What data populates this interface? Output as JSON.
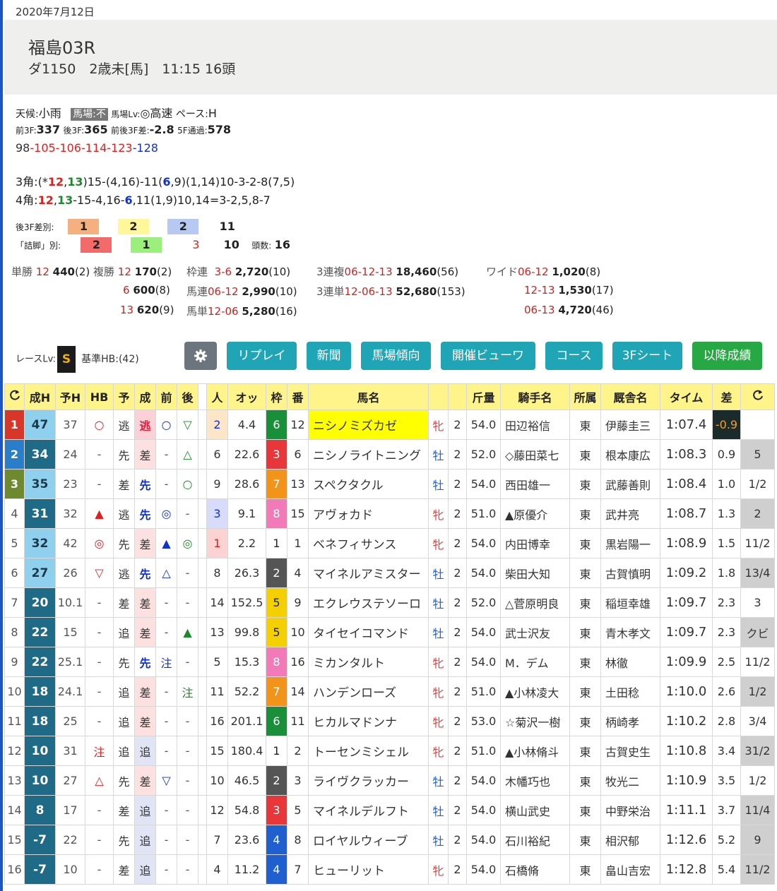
{
  "date": "2020年7月12日",
  "race": {
    "title": "福島03R",
    "sub": "ダ1150　2歳未[馬]　11:15 16頭"
  },
  "info": {
    "weather_label": "天候:",
    "weather": "小雨",
    "track_label": "馬場:",
    "track": "不",
    "tracklv_label": "馬場Lv:",
    "tracklv": "◎高速",
    "pace_label": "ペース:",
    "pace": "H",
    "f3_label": "前3F:",
    "f3": "337",
    "l3_label": "後3F:",
    "l3": "365",
    "diff_label": "前後3F差:",
    "diff": "-2.8",
    "pass_label": "5F通過:",
    "pass": "578",
    "lap": [
      "98",
      "-105",
      "-106",
      "-114",
      "-123",
      "-128"
    ],
    "corner3_label": "3角:",
    "corner4_label": "4角:"
  },
  "l3diff": {
    "label": "後3F差別:",
    "v1": "1",
    "v2": "2",
    "v3": "2",
    "v4": "11"
  },
  "tsume": {
    "label": "「詰脚」別:",
    "v1": "2",
    "v2": "1",
    "v3": "3",
    "v4": "10",
    "heads_label": "頭数:",
    "heads": "16"
  },
  "payout": {
    "tan_label": "単勝",
    "tan_no": "12",
    "tan_val": "440",
    "tan_pop": "(2)",
    "fuku_label": "複勝",
    "fuku": [
      {
        "no": "12",
        "val": "170",
        "pop": "(2)"
      },
      {
        "no": "6",
        "val": "600",
        "pop": "(8)"
      },
      {
        "no": "13",
        "val": "620",
        "pop": "(9)"
      }
    ],
    "wakuren_label": "枠連",
    "wakuren_no": "3-6",
    "wakuren_val": "2,720",
    "wakuren_pop": "(10)",
    "umaren_label": "馬連",
    "umaren_no": "06-12",
    "umaren_val": "2,990",
    "umaren_pop": "(10)",
    "umatan_label": "馬単",
    "umatan_no": "12-06",
    "umatan_val": "5,280",
    "umatan_pop": "(16)",
    "sanfuku_label": "3連複",
    "sanfuku_no": "06-12-13",
    "sanfuku_val": "18,460",
    "sanfuku_pop": "(56)",
    "santan_label": "3連単",
    "santan_no": "12-06-13",
    "santan_val": "52,680",
    "santan_pop": "(153)",
    "wide_label": "ワイド",
    "wide": [
      {
        "no": "06-12",
        "val": "1,020",
        "pop": "(8)"
      },
      {
        "no": "12-13",
        "val": "1,530",
        "pop": "(17)"
      },
      {
        "no": "06-13",
        "val": "4,720",
        "pop": "(46)"
      }
    ]
  },
  "racelv": {
    "label": "レースLv:",
    "grade": "S",
    "base": "基準HB:(42)"
  },
  "buttons": [
    "リプレイ",
    "新聞",
    "馬場傾向",
    "開催ビューワ",
    "コース",
    "3Fシート",
    "以降成績"
  ],
  "table": {
    "headers": [
      "成H",
      "予H",
      "HB",
      "予",
      "成",
      "前",
      "後",
      "人",
      "オッ",
      "枠",
      "番",
      "馬名",
      "斤量",
      "騎手名",
      "所属",
      "厩舎名",
      "タイム",
      "差"
    ],
    "rows": [
      {
        "rk": "1",
        "seih": "47",
        "yoh": "37",
        "hb": "○",
        "yo": "逃",
        "sei": "逃",
        "mae": "○",
        "ato": "▽",
        "pop": "2",
        "odds": "4.4",
        "waku": "6",
        "ban": "12",
        "name": "ニシノミズカゼ",
        "sex": "牝",
        "age": "2",
        "kin": "54.0",
        "jockey": "田辺裕信",
        "aff": "東",
        "trainer": "伊藤圭三",
        "time": "1:07.4",
        "diff": "-0.9",
        "gap": ""
      },
      {
        "rk": "2",
        "seih": "34",
        "yoh": "24",
        "hb": "-",
        "yo": "先",
        "sei": "差",
        "mae": "-",
        "ato": "△",
        "pop": "6",
        "odds": "22.6",
        "waku": "3",
        "ban": "6",
        "name": "ニシノライトニング",
        "sex": "牡",
        "age": "2",
        "kin": "52.0",
        "jockey": "◇藤田菜七",
        "aff": "東",
        "trainer": "根本康広",
        "time": "1:08.3",
        "diff": "0.9",
        "gap": "5"
      },
      {
        "rk": "3",
        "seih": "35",
        "yoh": "23",
        "hb": "-",
        "yo": "差",
        "sei": "先",
        "mae": "-",
        "ato": "○",
        "pop": "9",
        "odds": "28.6",
        "waku": "7",
        "ban": "13",
        "name": "スペクタクル",
        "sex": "牡",
        "age": "2",
        "kin": "54.0",
        "jockey": "西田雄一",
        "aff": "東",
        "trainer": "武藤善則",
        "time": "1:08.4",
        "diff": "1.0",
        "gap": "1/2"
      },
      {
        "rk": "4",
        "seih": "31",
        "yoh": "32",
        "hb": "▲",
        "yo": "逃",
        "sei": "先",
        "mae": "◎",
        "ato": "-",
        "pop": "3",
        "odds": "9.1",
        "waku": "8",
        "ban": "15",
        "name": "アヴォカド",
        "sex": "牝",
        "age": "2",
        "kin": "51.0",
        "jockey": "▲原優介",
        "aff": "東",
        "trainer": "武井亮",
        "time": "1:08.7",
        "diff": "1.3",
        "gap": "2"
      },
      {
        "rk": "5",
        "seih": "32",
        "yoh": "42",
        "hb": "◎",
        "yo": "先",
        "sei": "差",
        "mae": "▲",
        "ato": "◎",
        "pop": "1",
        "odds": "2.2",
        "waku": "1",
        "ban": "1",
        "name": "ベネフィサンス",
        "sex": "牝",
        "age": "2",
        "kin": "54.0",
        "jockey": "内田博幸",
        "aff": "東",
        "trainer": "黒岩陽一",
        "time": "1:08.9",
        "diff": "1.5",
        "gap": "11/2"
      },
      {
        "rk": "6",
        "seih": "27",
        "yoh": "26",
        "hb": "▽",
        "yo": "逃",
        "sei": "先",
        "mae": "△",
        "ato": "-",
        "pop": "8",
        "odds": "26.3",
        "waku": "2",
        "ban": "4",
        "name": "マイネルアミスター",
        "sex": "牡",
        "age": "2",
        "kin": "54.0",
        "jockey": "柴田大知",
        "aff": "東",
        "trainer": "古賀慎明",
        "time": "1:09.2",
        "diff": "1.8",
        "gap": "13/4"
      },
      {
        "rk": "7",
        "seih": "20",
        "yoh": "10.1",
        "hb": "-",
        "yo": "差",
        "sei": "差",
        "mae": "-",
        "ato": "-",
        "pop": "14",
        "odds": "152.5",
        "waku": "5",
        "ban": "9",
        "name": "エクレウステソーロ",
        "sex": "牡",
        "age": "2",
        "kin": "52.0",
        "jockey": "△菅原明良",
        "aff": "東",
        "trainer": "稲垣幸雄",
        "time": "1:09.7",
        "diff": "2.3",
        "gap": "3"
      },
      {
        "rk": "8",
        "seih": "22",
        "yoh": "15",
        "hb": "-",
        "yo": "追",
        "sei": "差",
        "mae": "-",
        "ato": "▲",
        "pop": "13",
        "odds": "99.8",
        "waku": "5",
        "ban": "10",
        "name": "タイセイコマンド",
        "sex": "牡",
        "age": "2",
        "kin": "54.0",
        "jockey": "武士沢友",
        "aff": "東",
        "trainer": "青木孝文",
        "time": "1:09.7",
        "diff": "2.3",
        "gap": "クビ"
      },
      {
        "rk": "9",
        "seih": "22",
        "yoh": "25.1",
        "hb": "-",
        "yo": "先",
        "sei": "先",
        "mae": "注",
        "ato": "-",
        "pop": "5",
        "odds": "15.3",
        "waku": "8",
        "ban": "16",
        "name": "ミカンタルト",
        "sex": "牝",
        "age": "2",
        "kin": "54.0",
        "jockey": "M．デム",
        "aff": "東",
        "trainer": "林徹",
        "time": "1:09.9",
        "diff": "2.5",
        "gap": "11/2"
      },
      {
        "rk": "10",
        "seih": "18",
        "yoh": "24.1",
        "hb": "-",
        "yo": "追",
        "sei": "差",
        "mae": "-",
        "ato": "注",
        "pop": "11",
        "odds": "52.2",
        "waku": "7",
        "ban": "14",
        "name": "ハンデンローズ",
        "sex": "牝",
        "age": "2",
        "kin": "51.0",
        "jockey": "▲小林凌大",
        "aff": "東",
        "trainer": "土田稔",
        "time": "1:10.0",
        "diff": "2.6",
        "gap": "1/2"
      },
      {
        "rk": "11",
        "seih": "18",
        "yoh": "25",
        "hb": "-",
        "yo": "追",
        "sei": "差",
        "mae": "-",
        "ato": "-",
        "pop": "16",
        "odds": "201.1",
        "waku": "6",
        "ban": "11",
        "name": "ヒカルマドンナ",
        "sex": "牝",
        "age": "2",
        "kin": "53.0",
        "jockey": "☆菊沢一樹",
        "aff": "東",
        "trainer": "柄崎孝",
        "time": "1:10.2",
        "diff": "2.8",
        "gap": "3/4"
      },
      {
        "rk": "12",
        "seih": "10",
        "yoh": "31",
        "hb": "注",
        "yo": "追",
        "sei": "追",
        "mae": "-",
        "ato": "-",
        "pop": "15",
        "odds": "180.4",
        "waku": "1",
        "ban": "2",
        "name": "トーセンミシェル",
        "sex": "牝",
        "age": "2",
        "kin": "51.0",
        "jockey": "▲小林脩斗",
        "aff": "東",
        "trainer": "古賀史生",
        "time": "1:10.8",
        "diff": "3.4",
        "gap": "31/2"
      },
      {
        "rk": "13",
        "seih": "10",
        "yoh": "27",
        "hb": "△",
        "yo": "先",
        "sei": "差",
        "mae": "▽",
        "ato": "-",
        "pop": "10",
        "odds": "46.5",
        "waku": "2",
        "ban": "3",
        "name": "ライヴクラッカー",
        "sex": "牡",
        "age": "2",
        "kin": "54.0",
        "jockey": "木幡巧也",
        "aff": "東",
        "trainer": "牧光二",
        "time": "1:10.9",
        "diff": "3.5",
        "gap": "1/2"
      },
      {
        "rk": "14",
        "seih": "8",
        "yoh": "17",
        "hb": "-",
        "yo": "差",
        "sei": "追",
        "mae": "-",
        "ato": "-",
        "pop": "12",
        "odds": "54.8",
        "waku": "3",
        "ban": "5",
        "name": "マイネルデルフト",
        "sex": "牡",
        "age": "2",
        "kin": "54.0",
        "jockey": "横山武史",
        "aff": "東",
        "trainer": "中野栄治",
        "time": "1:11.1",
        "diff": "3.7",
        "gap": "11/4"
      },
      {
        "rk": "15",
        "seih": "-7",
        "yoh": "22",
        "hb": "-",
        "yo": "先",
        "sei": "追",
        "mae": "-",
        "ato": "-",
        "pop": "7",
        "odds": "23.6",
        "waku": "4",
        "ban": "8",
        "name": "ロイヤルウィーブ",
        "sex": "牡",
        "age": "2",
        "kin": "54.0",
        "jockey": "石川裕紀",
        "aff": "東",
        "trainer": "相沢郁",
        "time": "1:12.6",
        "diff": "5.2",
        "gap": "9"
      },
      {
        "rk": "16",
        "seih": "-7",
        "yoh": "10",
        "hb": "-",
        "yo": "差",
        "sei": "追",
        "mae": "-",
        "ato": "-",
        "pop": "4",
        "odds": "11.2",
        "waku": "4",
        "ban": "7",
        "name": "ヒューリット",
        "sex": "牝",
        "age": "2",
        "kin": "54.0",
        "jockey": "石橋脩",
        "aff": "東",
        "trainer": "畠山吉宏",
        "time": "1:12.8",
        "diff": "5.4",
        "gap": "11/2"
      }
    ]
  },
  "colors": {
    "accent": "#1fa5b5",
    "gear": "#6c757d",
    "green_btn": "#28a745"
  }
}
